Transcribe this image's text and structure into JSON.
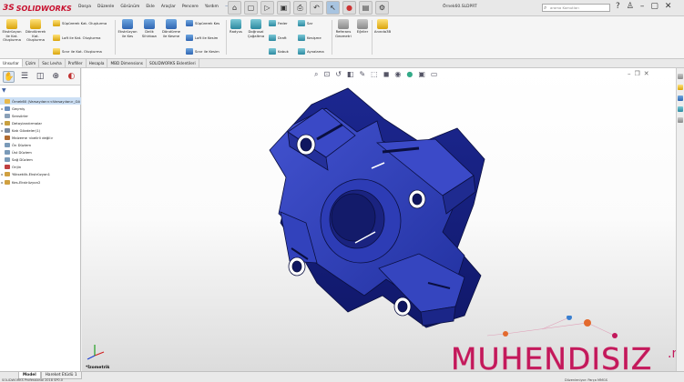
{
  "app": {
    "logo_text": "SOLIDWORKS",
    "logo_mark": "3S",
    "filename": "Örnek60.SLDPRT",
    "search_placeholder": "arama Komutları"
  },
  "menus": [
    "Dosya",
    "Düzenle",
    "Görünüm",
    "Ekle",
    "Araçlar",
    "Pencere",
    "Yardım"
  ],
  "ribbon": {
    "extrude_boss": "Ekstrüzyon ile Kat. Oluşturma",
    "revolve_boss": "Döndürerek Kat. Oluşturma",
    "swept_boss": "Süpürerek Kat. Oluşturma",
    "loft_boss": "Loft ile Kat. Oluşturma",
    "boundary_boss": "Sınır ile Kat. Oluşturma",
    "extrude_cut": "Ekstrüzyon ile Kes",
    "hole_wizard": "Delik Sihirbazı",
    "revolve_cut": "Döndürme ile Kesme",
    "swept_cut": "Süpürerek Kes",
    "loft_cut": "Loft ile Kesim",
    "boundary_cut": "Sınır ile Kesim",
    "fillet": "Radyus",
    "linear_pattern": "Doğrusal Çoğaltma",
    "rib": "Feder",
    "draft": "Draft",
    "shell": "Kabuk",
    "wrap": "Sar",
    "intersect": "Kesişme",
    "mirror": "Aynalama",
    "ref_geometry": "Referans Geometri",
    "curves": "Eğriler",
    "instant3d": "Anında3B"
  },
  "tabs": [
    {
      "label": "Unsurlar",
      "active": true
    },
    {
      "label": "Çizim",
      "active": false
    },
    {
      "label": "Sac Levha",
      "active": false
    },
    {
      "label": "Profiller",
      "active": false
    },
    {
      "label": "Hesapla",
      "active": false
    },
    {
      "label": "MBD Dimensions",
      "active": false
    },
    {
      "label": "SOLIDWORKS Eklentileri",
      "active": false
    }
  ],
  "tree": [
    {
      "label": "Örnek60 (Varsayılan<<Varsayılan>_Gö",
      "arrow": "",
      "color": "#e8b84a"
    },
    {
      "label": "Geçmiş",
      "arrow": "▸",
      "color": "#6a8fbf"
    },
    {
      "label": "Sensörler",
      "arrow": "",
      "color": "#8aa0b8"
    },
    {
      "label": "Detaylandırmalar",
      "arrow": "▸",
      "color": "#c8a040"
    },
    {
      "label": "Katı Gövdeler(1)",
      "arrow": "▸",
      "color": "#7a8aa0"
    },
    {
      "label": "Malzeme <belirli değil>",
      "arrow": "",
      "color": "#b06a30"
    },
    {
      "label": "Ön Düzlem",
      "arrow": "",
      "color": "#7a9ab8"
    },
    {
      "label": "Üst Düzlem",
      "arrow": "",
      "color": "#7a9ab8"
    },
    {
      "label": "Sağ Düzlem",
      "arrow": "",
      "color": "#7a9ab8"
    },
    {
      "label": "Orijin",
      "arrow": "",
      "color": "#c04040"
    },
    {
      "label": "Yükseklik-Ekstrüzyon1",
      "arrow": "▸",
      "color": "#d0a040"
    },
    {
      "label": "Kes-Ekstrüzyon2",
      "arrow": "▸",
      "color": "#d0a040"
    }
  ],
  "bottom_tabs": [
    "Model",
    "Hareket Etüdü 1"
  ],
  "status_text": "SOLIDWORKS Professional 2018 SP0.0",
  "status_right": "Düzenleniyor: Parça   MMGS",
  "view_label": "*İzometrik",
  "watermark": {
    "text": "MUHENDISIZ",
    "suffix": ".net"
  },
  "colors": {
    "part": "#2d3db8",
    "part_dark": "#1e2a8a",
    "accent": "#c2185b"
  }
}
